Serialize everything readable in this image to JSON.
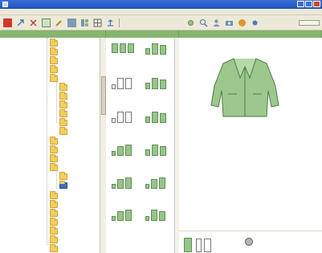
{
  "window": {
    "title": "",
    "icon": "app-window-icon"
  },
  "menu": {
    "items": [
      "",
      "",
      "",
      "",
      ""
    ]
  },
  "toolbar": {
    "buttons": [
      {
        "icon": "red-square-icon"
      },
      {
        "icon": "arrow-icon"
      },
      {
        "icon": "cross-icon"
      },
      {
        "icon": "shirt-icon"
      },
      {
        "icon": "pencil-icon"
      },
      {
        "icon": "copy-icon"
      },
      {
        "icon": "layout-icon"
      },
      {
        "icon": "grid-icon"
      },
      {
        "icon": "export-icon"
      },
      {
        "icon": "tool-icon"
      },
      {
        "icon": "zoom-icon"
      },
      {
        "icon": "user-icon"
      },
      {
        "icon": "camera-icon"
      },
      {
        "icon": "help-icon"
      }
    ],
    "field_value": ""
  },
  "panels": {
    "tree_header": "",
    "gallery_header": "",
    "preview_header": ""
  },
  "tree": {
    "items": [
      "",
      "",
      "",
      "",
      "",
      "",
      "",
      "",
      "",
      "",
      "",
      "",
      "",
      "",
      "",
      "",
      "",
      "",
      "",
      "",
      "",
      "",
      "",
      "",
      "",
      "",
      ""
    ]
  },
  "gallery": {
    "captions": [
      "",
      "",
      "",
      "",
      "",
      "",
      "",
      "",
      "",
      "",
      "",
      ""
    ]
  },
  "preview": {
    "garment": "green-jacket-drawing",
    "color": "#9cc88e"
  },
  "colors": {
    "accent_green": "#86b56e",
    "folder": "#f0cf5d",
    "selection": "#3f6fc4",
    "close": "#d2431f"
  }
}
